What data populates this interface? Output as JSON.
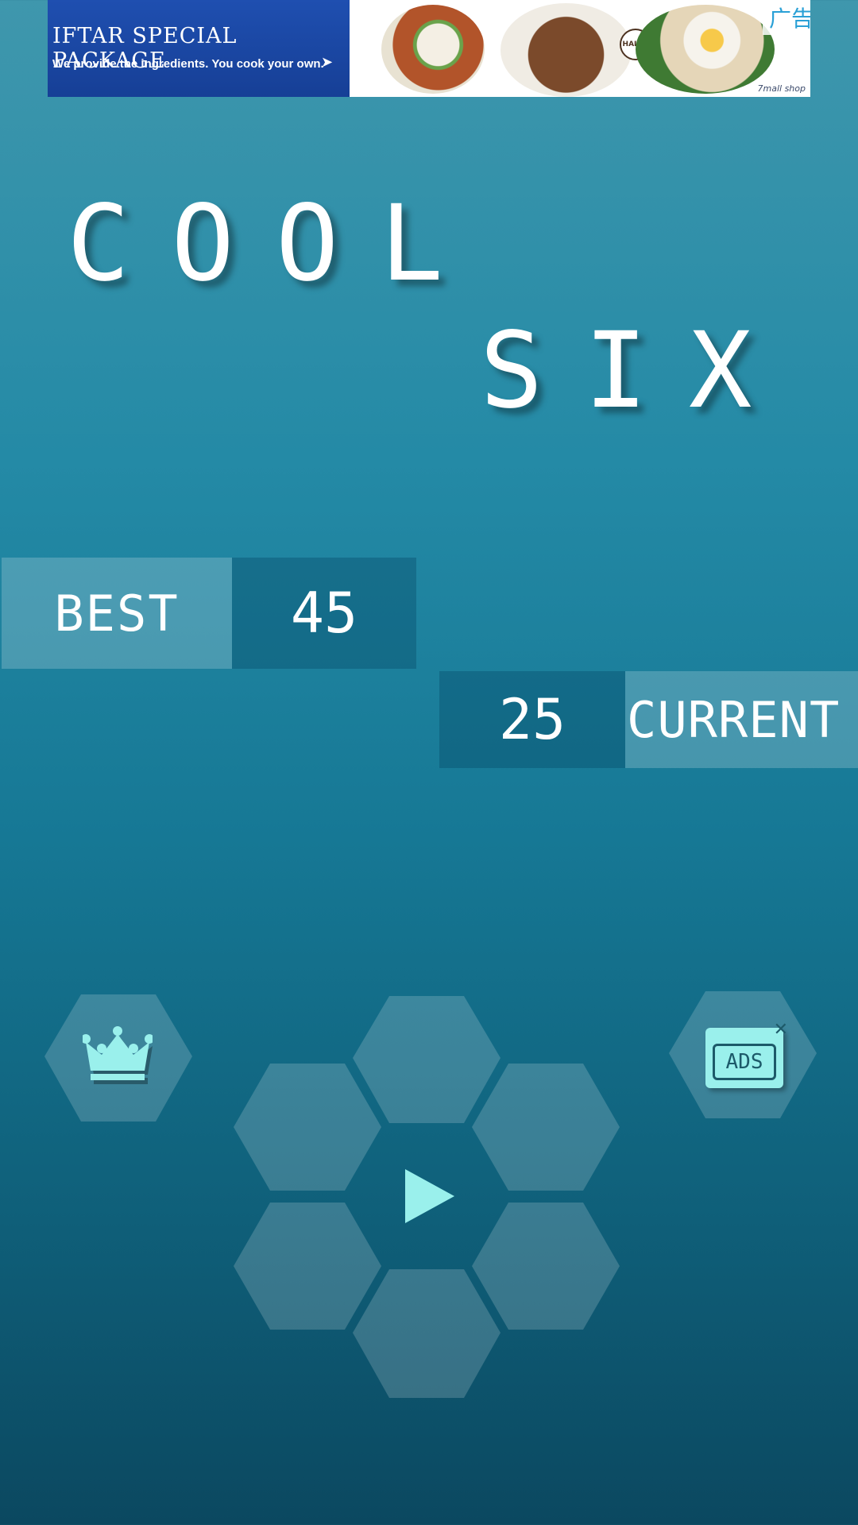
{
  "ad": {
    "headline": "IFTAR SPECIAL PACKAGE",
    "subline": "We provide the ingredients. You cook your own.",
    "halal_badge": "HALAL",
    "brand": "7mall shop",
    "label": "广告",
    "close": "✕"
  },
  "title": {
    "line1": "COOL",
    "line2": "SIX"
  },
  "scores": {
    "best_label": "BEST",
    "best_value": "45",
    "current_value": "25",
    "current_label": "CURRENT"
  },
  "buttons": {
    "leaderboard_icon": "crown-icon",
    "play_icon": "play-icon",
    "remove_ads_icon": "remove-ads-icon",
    "remove_ads_text": "ADS",
    "remove_ads_close": "✕"
  },
  "colors": {
    "icon_accent": "#9af0ec",
    "hex_fill": "rgba(255,255,255,0.18)",
    "background_top": "#3f97ad",
    "background_bottom": "#0b4860"
  }
}
